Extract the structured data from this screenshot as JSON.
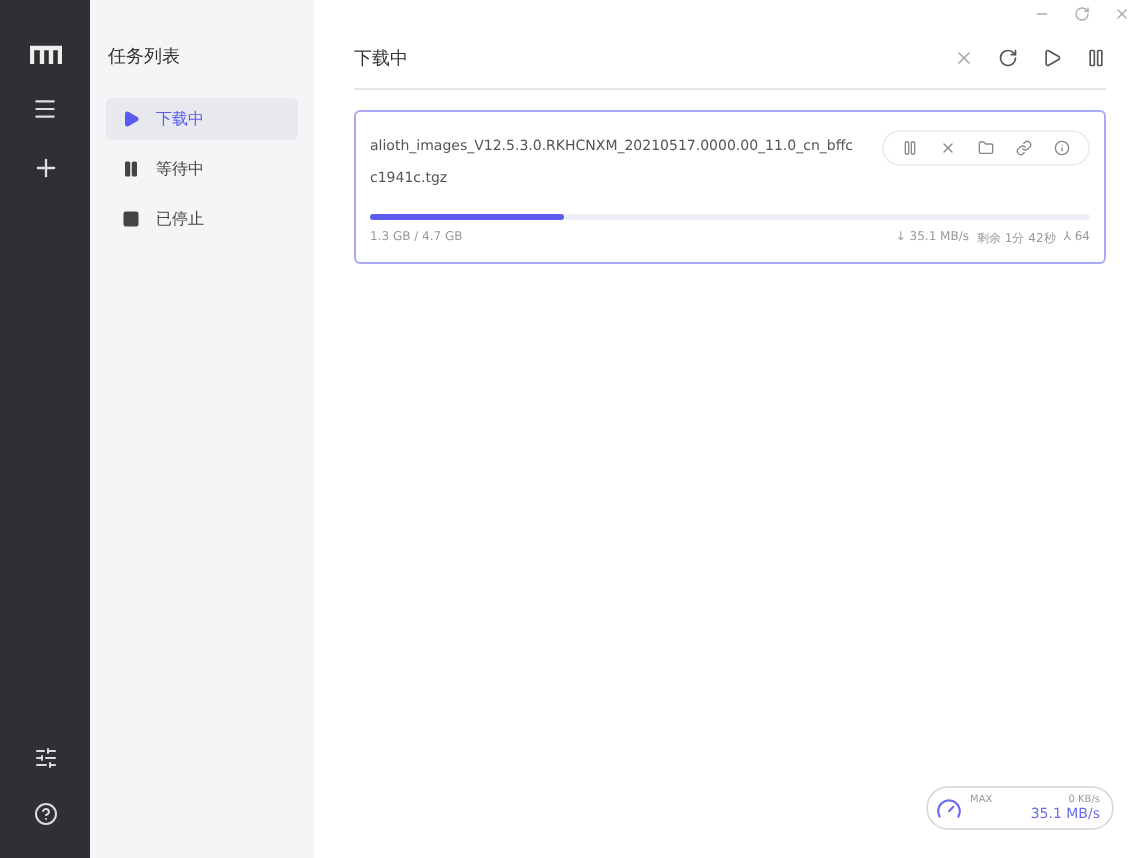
{
  "sidebar": {
    "panel_title": "任务列表",
    "items": [
      {
        "kind": "play",
        "label": "下载中",
        "selected": true
      },
      {
        "kind": "pause",
        "label": "等待中",
        "selected": false
      },
      {
        "kind": "stop",
        "label": "已停止",
        "selected": false
      }
    ]
  },
  "main": {
    "title": "下载中",
    "tasks": [
      {
        "name": "alioth_images_V12.5.3.0.RKHCNXM_20210517.0000.00_11.0_cn_bffcc1941c.tgz",
        "level": 0.27,
        "size": "1.3 GB / 4.7 GB",
        "speed": "↓ 35.1 MB/s",
        "remaining": "剩余 1分 42秒",
        "connections": "⅄ 64"
      }
    ]
  },
  "speedometer": {
    "label": "MAX",
    "upload": "0 KB/s",
    "download": "35.1 MB/s"
  }
}
